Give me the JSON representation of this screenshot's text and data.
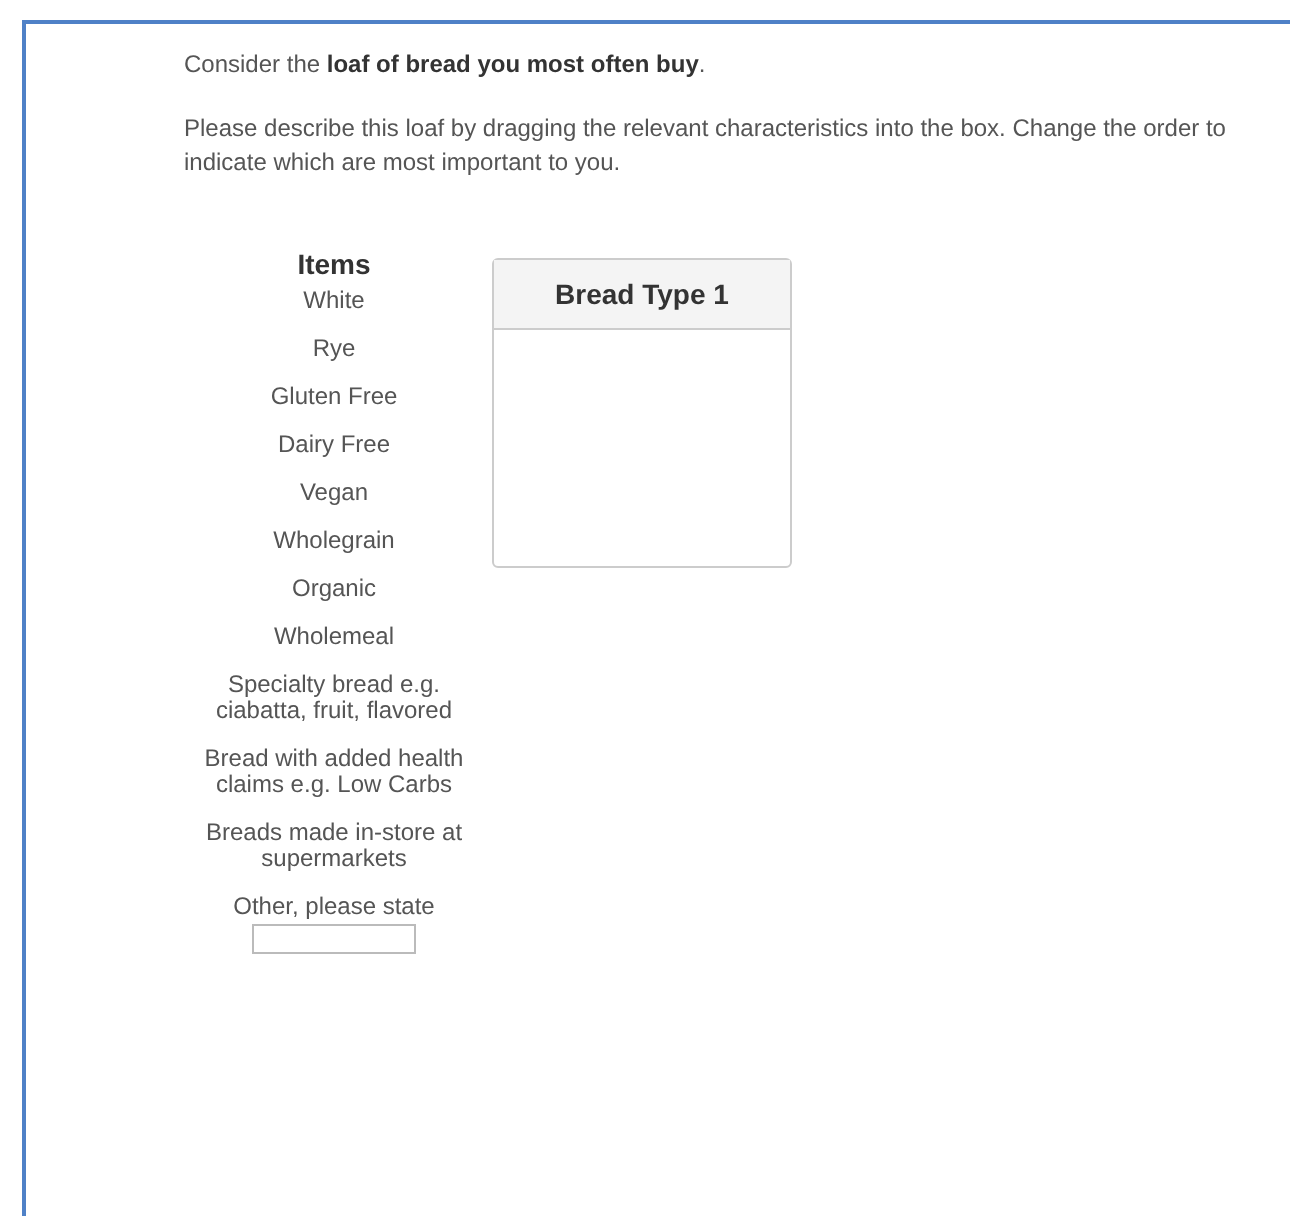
{
  "intro": "Consider the **loaf of bread you most often buy**.",
  "instructions": "Please describe this loaf by dragging the relevant characteristics into the box.  Change the order to indicate which are most important to you.",
  "items": {
    "heading": "Items",
    "list": [
      {
        "kind": "plain",
        "label": "White"
      },
      {
        "kind": "plain",
        "label": "Rye"
      },
      {
        "kind": "plain",
        "label": "Gluten Free"
      },
      {
        "kind": "plain",
        "label": "Dairy Free"
      },
      {
        "kind": "plain",
        "label": "Vegan"
      },
      {
        "kind": "plain",
        "label": "Wholegrain"
      },
      {
        "kind": "plain",
        "label": "Organic"
      },
      {
        "kind": "plain",
        "label": "Wholemeal"
      },
      {
        "kind": "plain",
        "label": "Specialty bread e.g. ciabatta, fruit, flavored"
      },
      {
        "kind": "plain",
        "label": "Bread with added health claims e.g. Low Carbs"
      },
      {
        "kind": "plain",
        "label": "Breads made in-store at supermarkets"
      },
      {
        "kind": "text_entry",
        "label": "Other, please state"
      }
    ]
  },
  "groups": [
    {
      "title": "Bread Type 1"
    }
  ]
}
